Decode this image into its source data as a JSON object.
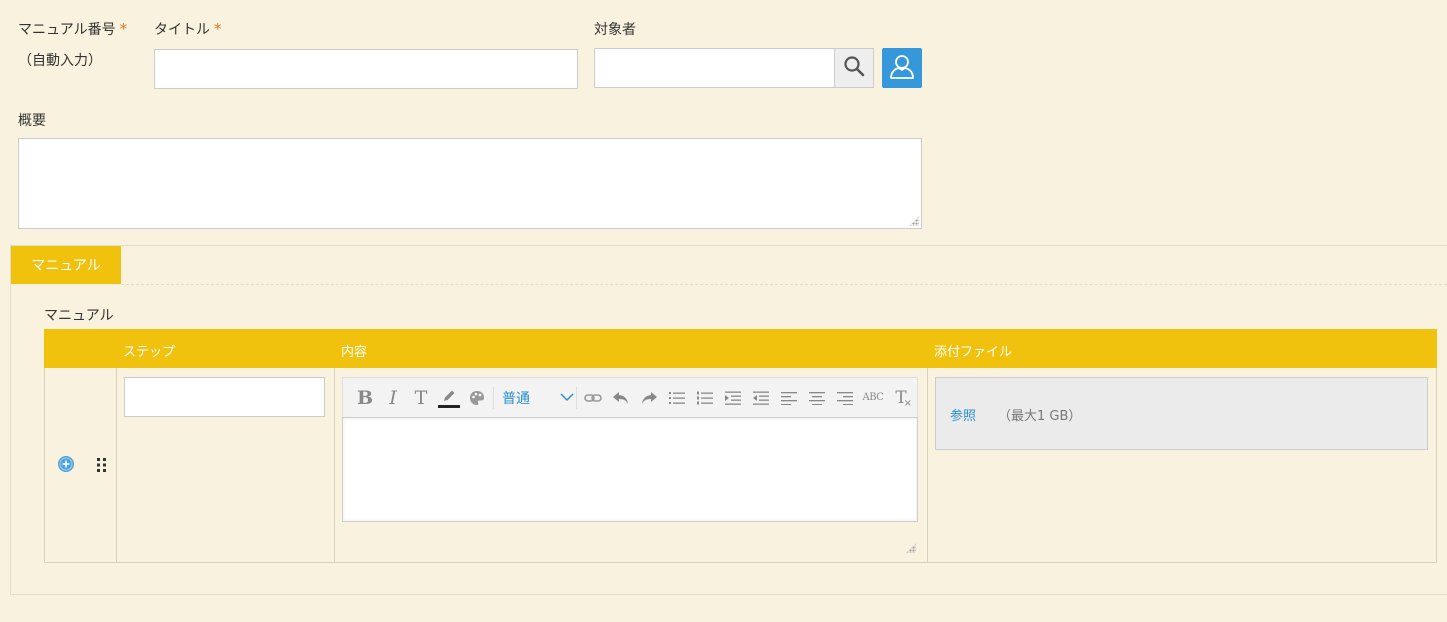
{
  "form": {
    "manual_number": {
      "label": "マニュアル番号",
      "required_mark": "*",
      "note": "（自動入力）"
    },
    "title": {
      "label": "タイトル",
      "required_mark": "*",
      "value": ""
    },
    "target": {
      "label": "対象者",
      "value": ""
    },
    "summary": {
      "label": "概要",
      "value": ""
    }
  },
  "tabs": [
    {
      "label": "マニュアル",
      "active": true
    }
  ],
  "manual_section": {
    "label": "マニュアル",
    "columns": [
      "ステップ",
      "内容",
      "添付ファイル"
    ],
    "rows": [
      {
        "step": "",
        "content": "",
        "attachment": {
          "browse_label": "参照",
          "limit": "（最大1 GB）"
        }
      }
    ]
  },
  "editor": {
    "format_select": "普通",
    "tools": [
      "bold-icon",
      "italic-icon",
      "text-format-icon",
      "pen-color-icon",
      "palette-icon",
      "link-icon",
      "undo-icon",
      "redo-icon",
      "bulleted-list-icon",
      "numbered-list-icon",
      "indent-icon",
      "outdent-icon",
      "align-left-icon",
      "align-center-icon",
      "align-right-icon",
      "spellcheck-icon",
      "clear-format-icon"
    ]
  },
  "colors": {
    "accent": "#f0c20e",
    "link": "#2a8fd1",
    "user_button": "#3498db",
    "required": "#e07a1f",
    "background": "#f8f2de"
  }
}
